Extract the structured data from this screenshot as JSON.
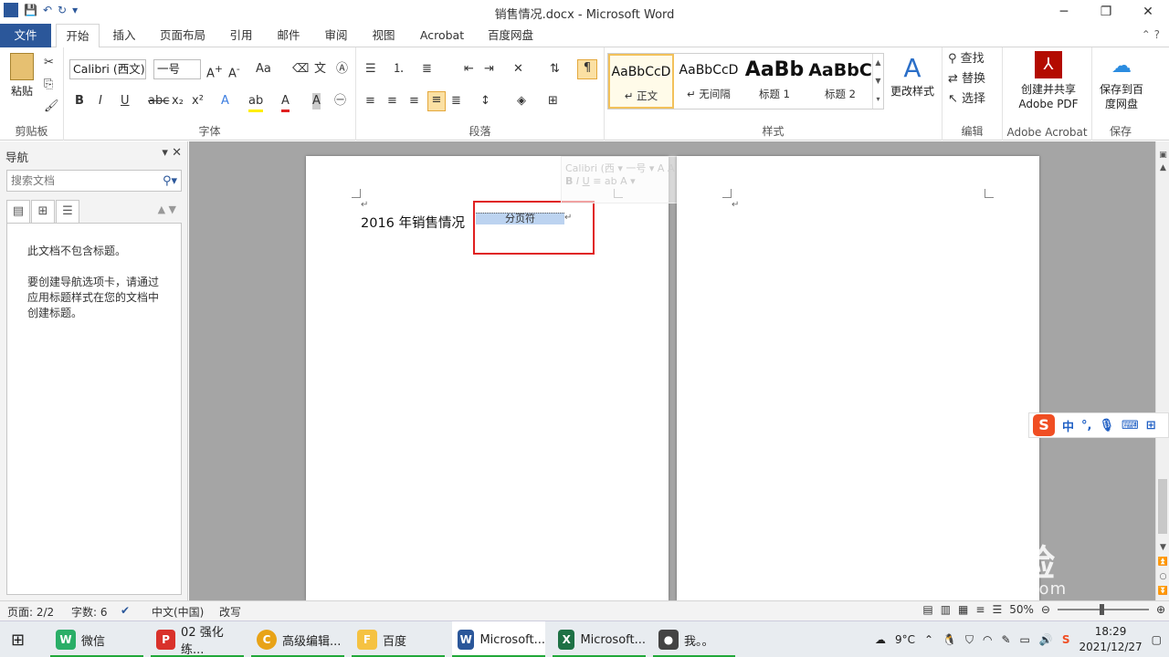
{
  "window": {
    "title": "销售情况.docx - Microsoft Word"
  },
  "qat": {
    "save": "💾",
    "undo": "↶",
    "redo": "↻"
  },
  "tabs": {
    "file": "文件",
    "home": "开始",
    "insert": "插入",
    "layout": "页面布局",
    "references": "引用",
    "mailings": "邮件",
    "review": "审阅",
    "view": "视图",
    "acrobat": "Acrobat",
    "baidu": "百度网盘"
  },
  "ribbon": {
    "clipboard": {
      "label": "剪贴板",
      "paste": "粘贴"
    },
    "font": {
      "label": "字体",
      "name": "Calibri (西文)",
      "size": "一号"
    },
    "paragraph": {
      "label": "段落"
    },
    "styles": {
      "label": "样式",
      "items": [
        {
          "preview": "AaBbCcD",
          "name": "↵ 正文"
        },
        {
          "preview": "AaBbCcD",
          "name": "↵ 无间隔"
        },
        {
          "preview": "AaBb",
          "name": "标题 1"
        },
        {
          "preview": "AaBbC",
          "name": "标题 2"
        }
      ],
      "change": "更改样式"
    },
    "editing": {
      "label": "编辑",
      "find": "查找",
      "replace": "替换",
      "select": "选择"
    },
    "acrobat": {
      "label": "Adobe Acrobat",
      "create": "创建并共享 Adobe PDF"
    },
    "save": {
      "label": "保存",
      "baidu": "保存到百度网盘"
    }
  },
  "nav": {
    "title": "导航",
    "search_placeholder": "搜索文档",
    "msg1": "此文档不包含标题。",
    "msg2": "要创建导航选项卡，请通过应用标题样式在您的文档中创建标题。"
  },
  "doc": {
    "heading": "2016 年销售情况",
    "pagebreak": "分页符",
    "mini_font": "Calibri (西",
    "mini_size": "一号"
  },
  "status": {
    "page": "页面: 2/2",
    "words": "字数: 6",
    "lang": "中文(中国)",
    "mode": "改写",
    "zoom": "50%"
  },
  "taskbar": {
    "items": [
      {
        "label": "微信",
        "color": "#2aae67",
        "glyph": "W"
      },
      {
        "label": "02 强化练...",
        "color": "#d9322b",
        "glyph": "P"
      },
      {
        "label": "高级编辑...",
        "color": "#e8a317",
        "glyph": "C"
      },
      {
        "label": "百度",
        "color": "#f5c242",
        "glyph": "F"
      },
      {
        "label": "Microsoft...",
        "color": "#2b579a",
        "glyph": "W"
      },
      {
        "label": "Microsoft...",
        "color": "#1e7145",
        "glyph": "X"
      },
      {
        "label": "我。。",
        "color": "#444444",
        "glyph": "●"
      }
    ],
    "weather": "9°C",
    "time": "18:29",
    "date": "2021/12/27"
  },
  "ime": {
    "lang": "中",
    "punct": "°,"
  },
  "watermark": {
    "brand": "Bai 经验",
    "url": "jingyan.baidu.com"
  }
}
